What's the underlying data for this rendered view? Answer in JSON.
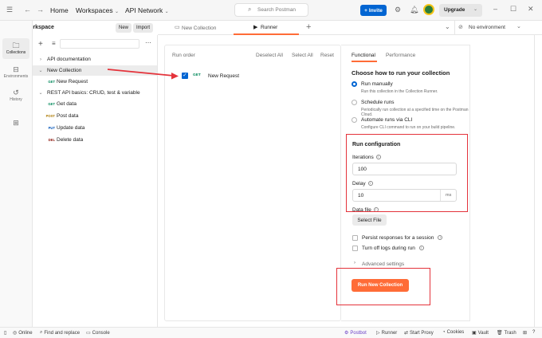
{
  "topbar": {
    "home": "Home",
    "workspaces": "Workspaces",
    "api_network": "API Network",
    "search_placeholder": "Search Postman",
    "invite": "Invite",
    "upgrade": "Upgrade"
  },
  "workspace": {
    "title": "My Workspace",
    "new_label": "New",
    "import_label": "Import"
  },
  "rail": {
    "items": [
      {
        "label": "Collections",
        "icon": "collections-icon"
      },
      {
        "label": "Environments",
        "icon": "environments-icon"
      },
      {
        "label": "History",
        "icon": "history-icon"
      },
      {
        "label": "",
        "icon": "apps-icon"
      }
    ]
  },
  "sidebar": {
    "tree": [
      {
        "name": "API documentation"
      },
      {
        "name": "New Collection"
      },
      {
        "method": "GET",
        "name": "New Request"
      },
      {
        "name": "REST API basics: CRUD, test & variable"
      },
      {
        "method": "GET",
        "name": "Get data"
      },
      {
        "method": "POST",
        "name": "Post data"
      },
      {
        "method": "PUT",
        "name": "Update data"
      },
      {
        "method": "DEL",
        "name": "Delete data"
      }
    ]
  },
  "tabs": {
    "items": [
      {
        "label": "New Collection",
        "icon": "collection-icon"
      },
      {
        "label": "Runner",
        "icon": "runner-icon"
      }
    ],
    "environment": "No environment"
  },
  "runner": {
    "run_order": "Run order",
    "deselect_all": "Deselect All",
    "select_all": "Select All",
    "reset": "Reset",
    "request_method": "GET",
    "request_name": "New Request"
  },
  "config": {
    "tab_functional": "Functional",
    "tab_performance": "Performance",
    "heading": "Choose how to run your collection",
    "options": [
      {
        "label": "Run manually",
        "desc": "Run this collection in the Collection Runner."
      },
      {
        "label": "Schedule runs",
        "desc": "Periodically run collection at a specified time on the Postman Cloud."
      },
      {
        "label": "Automate runs via CLI",
        "desc": "Configure CLI command to run on your build pipeline."
      }
    ],
    "run_configuration": "Run configuration",
    "iterations_label": "Iterations",
    "iterations_value": "100",
    "delay_label": "Delay",
    "delay_value": "10",
    "delay_unit": "ms",
    "data_file_label": "Data file",
    "select_file": "Select File",
    "persist_responses": "Persist responses for a session",
    "turn_off_logs": "Turn off logs during run",
    "advanced_settings": "Advanced settings",
    "run_button": "Run New Collection"
  },
  "statusbar": {
    "online": "Online",
    "find_replace": "Find and replace",
    "console": "Console",
    "postbot": "Postbot",
    "runner": "Runner",
    "start_proxy": "Start Proxy",
    "cookies": "Cookies",
    "vault": "Vault",
    "trash": "Trash"
  },
  "colors": {
    "accent": "#ff6c37",
    "primary": "#0265d2",
    "annotation": "#e4333b",
    "get": "#00885a",
    "post": "#ad7a03",
    "put": "#0053b8",
    "delete": "#8e1a10"
  }
}
